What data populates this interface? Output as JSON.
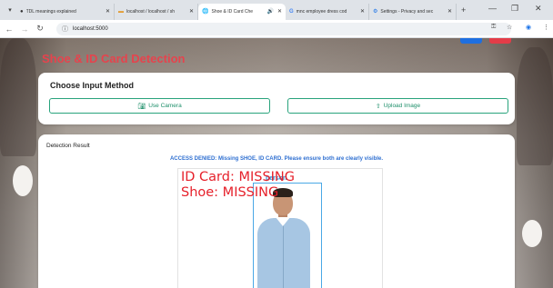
{
  "browser": {
    "tabs": [
      {
        "title": "TDL meanings explained",
        "active": false
      },
      {
        "title": "localhost / localhost / sh",
        "active": false
      },
      {
        "title": "Shoe & ID Card Che",
        "active": true
      },
      {
        "title": "mnc employee dress cod",
        "active": false
      },
      {
        "title": "Settings - Privacy and sec",
        "active": false
      }
    ],
    "url": "localhost:5000",
    "icons": {
      "tab_menu": "chevron-down-icon",
      "new_tab": "plus-icon",
      "back": "arrow-left-icon",
      "forward": "arrow-right-icon",
      "reload": "reload-icon",
      "site_info": "info-icon",
      "key": "key-icon",
      "bookmark": "star-icon",
      "profile": "profile-icon",
      "menu": "kebab-menu-icon",
      "minimize": "minimize-icon",
      "restore": "restore-icon",
      "close": "close-icon"
    }
  },
  "header": {
    "title": "Shoe & ID Card Detection",
    "title_color": "#e6434d"
  },
  "input_card": {
    "title": "Choose Input Method",
    "camera_button": "Use Camera",
    "camera_icon": "camera-icon",
    "upload_button": "Upload Image",
    "upload_icon": "upload-icon",
    "accent_color": "#28a37c"
  },
  "result_card": {
    "label": "Detection Result",
    "message": "ACCESS DENIED: Missing SHOE, ID CARD. Please ensure both are clearly visible.",
    "message_color": "#2e6fd1",
    "overlay_lines": [
      "ID Card: MISSING",
      "Shoe: MISSING"
    ],
    "overlay_color": "#e6212b",
    "detection_label": "person",
    "detection_color": "#4aa8e6"
  }
}
